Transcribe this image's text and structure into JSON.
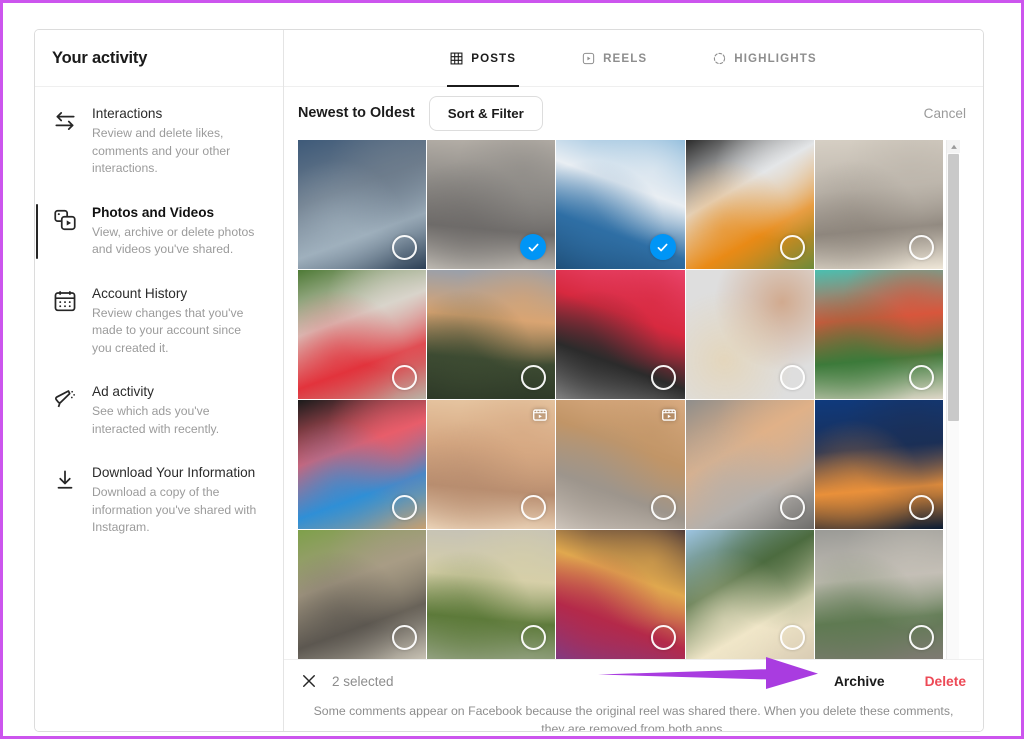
{
  "frame": {
    "border_color": "#cc55ee"
  },
  "sidebar": {
    "title": "Your activity",
    "items": [
      {
        "icon": "interactions-arrows-icon",
        "label": "Interactions",
        "desc": "Review and delete likes, comments and your other interactions.",
        "active": false
      },
      {
        "icon": "photos-and-videos-icon",
        "label": "Photos and Videos",
        "desc": "View, archive or delete photos and videos you've shared.",
        "active": true
      },
      {
        "icon": "calendar-icon",
        "label": "Account History",
        "desc": "Review changes that you've made to your account since you created it.",
        "active": false
      },
      {
        "icon": "megaphone-icon",
        "label": "Ad activity",
        "desc": "See which ads you've interacted with recently.",
        "active": false
      },
      {
        "icon": "download-arrow-icon",
        "label": "Download Your Information",
        "desc": "Download a copy of the information you've shared with Instagram.",
        "active": false
      }
    ]
  },
  "tabs": [
    {
      "label": "POSTS",
      "icon": "grid-icon",
      "active": true
    },
    {
      "label": "REELS",
      "icon": "reels-icon",
      "active": false
    },
    {
      "label": "HIGHLIGHTS",
      "icon": "highlights-circle-icon",
      "active": false
    }
  ],
  "sortbar": {
    "sort_label": "Newest to Oldest",
    "sort_filter_label": "Sort & Filter",
    "cancel_label": "Cancel"
  },
  "grid": {
    "columns": 5,
    "scrollbar": {
      "visible": true,
      "thumb_position_pct": 3,
      "thumb_size_pct": 51
    },
    "items": [
      {
        "caption": "mountain-river-valley",
        "selected": false,
        "reel": false,
        "colors": [
          "#3e5a79",
          "#6d7c8c",
          "#9fb0bd",
          "#2c3f55"
        ]
      },
      {
        "caption": "gravel-road-mountains",
        "selected": true,
        "reel": false,
        "colors": [
          "#b9b3ab",
          "#8d8a86",
          "#6e6b69",
          "#c9c4bc"
        ]
      },
      {
        "caption": "snow-peaks-lake-gate",
        "selected": true,
        "reel": false,
        "colors": [
          "#7fb3d8",
          "#e9eef3",
          "#2f6fa5",
          "#1d4a72"
        ]
      },
      {
        "caption": "orange-flower-in-snow",
        "selected": false,
        "reel": false,
        "colors": [
          "#2b2b2b",
          "#e4e6e8",
          "#e98a16",
          "#6d8a3a"
        ]
      },
      {
        "caption": "lake-sunrise-birds",
        "selected": false,
        "reel": false,
        "colors": [
          "#d6cfc4",
          "#bdb6ac",
          "#8e867d",
          "#efe7d8"
        ]
      },
      {
        "caption": "pink-flowers-red-phone",
        "selected": false,
        "reel": false,
        "colors": [
          "#4e7a36",
          "#d9d4cb",
          "#e2333c",
          "#b9b3a6"
        ]
      },
      {
        "caption": "sunset-clouds-house",
        "selected": false,
        "reel": false,
        "colors": [
          "#8d9fb5",
          "#d9a472",
          "#3d4b32",
          "#2b3626"
        ]
      },
      {
        "caption": "phones-on-pink-background",
        "selected": false,
        "reel": false,
        "colors": [
          "#ef4c78",
          "#d7293f",
          "#2b2b2b",
          "#8e8e8e"
        ]
      },
      {
        "caption": "toy-figures-on-table",
        "selected": false,
        "reel": false,
        "colors": [
          "#b4apd",
          "#c8875a",
          "#e9cf9f",
          "#4fba52"
        ]
      },
      {
        "caption": "succulents-top-view",
        "selected": false,
        "reel": false,
        "colors": [
          "#4bbfb0",
          "#d8563c",
          "#3c7a3a",
          "#ded7c8"
        ]
      },
      {
        "caption": "tablet-home-screen",
        "selected": false,
        "reel": false,
        "colors": [
          "#1b1b1b",
          "#e85d6a",
          "#2f8fd6",
          "#c8a070"
        ]
      },
      {
        "caption": "beach-sunset-people",
        "selected": false,
        "reel": true,
        "colors": [
          "#e8c9a5",
          "#d6a882",
          "#b88d6f",
          "#f2ddc2"
        ]
      },
      {
        "caption": "ginger-cat-sitting",
        "selected": false,
        "reel": true,
        "colors": [
          "#e0b188",
          "#c19567",
          "#9d958c",
          "#d6ccc2"
        ]
      },
      {
        "caption": "ginger-cat-lying",
        "selected": false,
        "reel": false,
        "colors": [
          "#8e8d8b",
          "#e0b188",
          "#b4b0ac",
          "#6e6d6b"
        ]
      },
      {
        "caption": "airplane-wing-sunset",
        "selected": false,
        "reel": false,
        "colors": [
          "#0f3a7d",
          "#1b2f56",
          "#e9903a",
          "#0a1b33"
        ]
      },
      {
        "caption": "tabby-cat-with-kitten",
        "selected": false,
        "reel": false,
        "colors": [
          "#7ea04a",
          "#a89c85",
          "#5c5750",
          "#c8c2b4"
        ]
      },
      {
        "caption": "rainbow-over-trees",
        "selected": false,
        "reel": false,
        "colors": [
          "#c3c0b8",
          "#d6cfa8",
          "#5d7a3a",
          "#9aa68a"
        ]
      },
      {
        "caption": "stage-decoration-house",
        "selected": false,
        "reel": false,
        "colors": [
          "#2b2035",
          "#e0a84e",
          "#b4294a",
          "#7a3d8a"
        ]
      },
      {
        "caption": "daisy-flower-in-hand",
        "selected": false,
        "reel": false,
        "colors": [
          "#9dc4e2",
          "#4c6b3f",
          "#f0e6c8",
          "#d9ccb4"
        ]
      },
      {
        "caption": "river-rocks-mountains",
        "selected": false,
        "reel": false,
        "colors": [
          "#9a9a96",
          "#c4bfb6",
          "#5f7a52",
          "#7e7a72"
        ]
      }
    ]
  },
  "bottom": {
    "close_icon": "close-x-icon",
    "selected_text": "2 selected",
    "archive_label": "Archive",
    "delete_label": "Delete",
    "delete_color": "#ed4956",
    "footnote": "Some comments appear on Facebook because the original reel was shared there. When you delete these comments, they are removed from both apps."
  },
  "annotation": {
    "arrow": {
      "color": "#a93ce0",
      "direction": "right",
      "points_to": "Archive"
    }
  }
}
